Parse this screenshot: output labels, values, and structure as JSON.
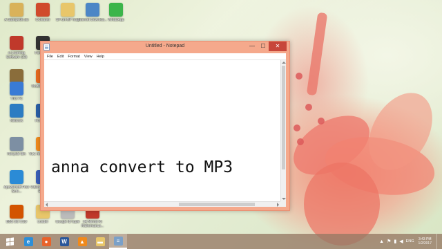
{
  "desktop": {
    "icons": [
      {
        "label": "A Stampede.sis",
        "icon": "file-icon",
        "color": "#d9b25a"
      },
      {
        "label": "CCleaner",
        "icon": "ccleaner-icon",
        "color": "#d04a2c"
      },
      {
        "label": "SP-on-MP map",
        "icon": "folder-icon",
        "color": "#e8c66a"
      },
      {
        "label": "Internet Downloa...",
        "icon": "document-icon",
        "color": "#4c86c6"
      },
      {
        "label": "WhatsApp",
        "icon": "whatsapp-icon",
        "color": "#3bb54a"
      },
      {
        "label": "e-Learning Software (10)",
        "icon": "elearning-icon",
        "color": "#c0392b"
      },
      {
        "label": "FontForge",
        "icon": "fontforge-icon",
        "color": "#333333"
      },
      {
        "label": "InfoSec",
        "icon": "app-icon",
        "color": "#8a6d3b"
      },
      {
        "label": "This PC",
        "icon": "computer-icon",
        "color": "#3a7bd5"
      },
      {
        "label": "Mozilla Firefox",
        "icon": "firefox-icon",
        "color": "#e66a1f"
      },
      {
        "label": "Network",
        "icon": "network-icon",
        "color": "#2c7cc2"
      },
      {
        "label": "Foxit PDF",
        "icon": "pdf-icon",
        "color": "#2a5fa6"
      },
      {
        "label": "Recycle Bin",
        "icon": "recycle-bin-icon",
        "color": "#7d8fa3"
      },
      {
        "label": "VLC media player",
        "icon": "vlc-icon",
        "color": "#f08a1c"
      },
      {
        "label": "Apowersoft Free Scre...",
        "icon": "apowersoft-icon",
        "color": "#2b8bd6"
      },
      {
        "label": "VideoPad Video Editor",
        "icon": "videopad-icon",
        "color": "#3a5fb8"
      },
      {
        "label": "BBS 3G CSD",
        "icon": "csd-icon",
        "color": "#d35400"
      },
      {
        "label": "Loader",
        "icon": "folder-icon",
        "color": "#e8c66a"
      },
      {
        "label": "Google ID tuple",
        "icon": "document-icon",
        "color": "#bbbbbb"
      },
      {
        "label": "04 Nirmal Ki Ridhemanus...",
        "icon": "pdf-icon",
        "color": "#c0392b"
      }
    ]
  },
  "notepad": {
    "title": "Untitled - Notepad",
    "controls": {
      "minimize": "—",
      "maximize": "☐",
      "close": "✕"
    },
    "menus": [
      "File",
      "Edit",
      "Format",
      "View",
      "Help"
    ],
    "content": "anna convert to MP3"
  },
  "taskbar": {
    "apps": [
      {
        "name": "internet-explorer",
        "glyph": "e",
        "color": "#2d8fd8",
        "active": false
      },
      {
        "name": "firefox",
        "glyph": "●",
        "color": "#e8632b",
        "active": false
      },
      {
        "name": "word",
        "glyph": "W",
        "color": "#2b579a",
        "active": false
      },
      {
        "name": "vlc",
        "glyph": "▲",
        "color": "#f08a1c",
        "active": false
      },
      {
        "name": "file-explorer",
        "glyph": "▬",
        "color": "#e8c66a",
        "active": false
      },
      {
        "name": "notepad",
        "glyph": "≡",
        "color": "#7aa0c8",
        "active": true
      }
    ],
    "tray": {
      "language": "ENG",
      "time": "3:43 PM",
      "date": "1/2/2017"
    }
  }
}
